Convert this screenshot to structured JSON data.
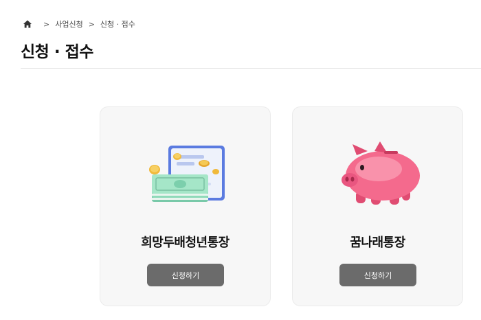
{
  "breadcrumb": {
    "home_icon": "home-icon",
    "items": [
      "사업신청",
      "신청 · 접수"
    ],
    "separator": ">"
  },
  "page_title": "신청 · 접수",
  "cards": [
    {
      "title": "희망두배청년통장",
      "button_label": "신청하기",
      "illustration": "money-tablet-illustration"
    },
    {
      "title": "꿈나래통장",
      "button_label": "신청하기",
      "illustration": "piggy-bank-illustration"
    }
  ],
  "colors": {
    "card_bg": "#f7f7f7",
    "button_bg": "#6b6b6b",
    "divider": "#e6e6e6"
  }
}
